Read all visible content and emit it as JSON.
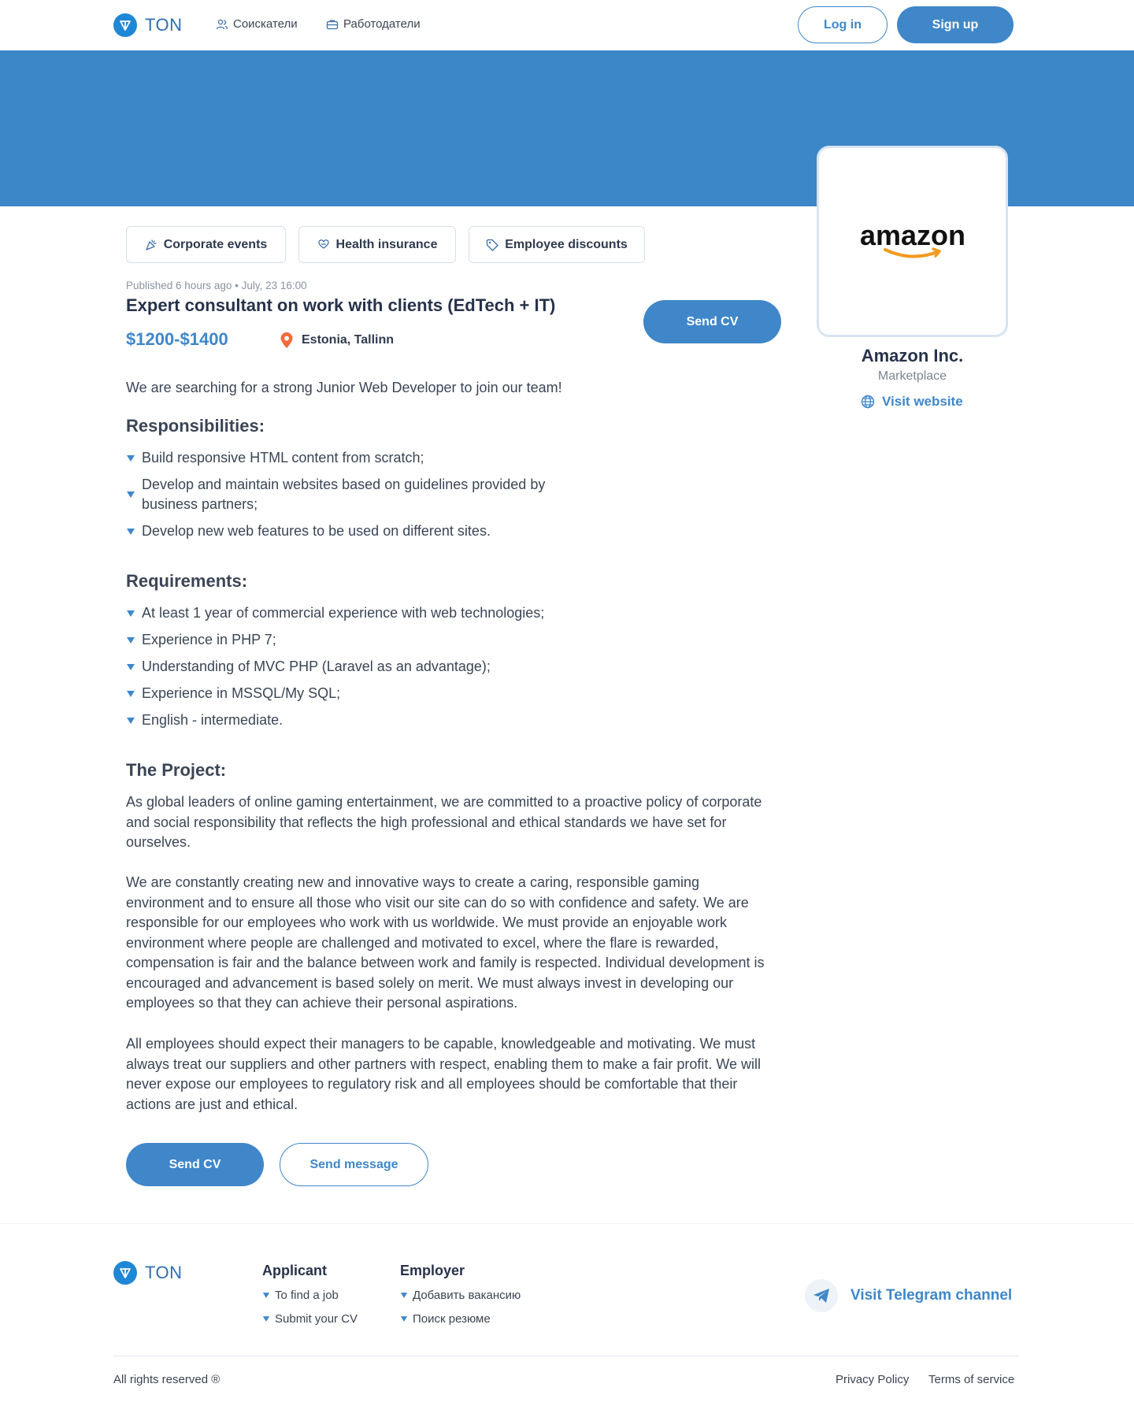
{
  "brand": {
    "name": "TON",
    "accent": "#3f87c9",
    "banner_color": "#3c87c7"
  },
  "nav": {
    "seekers": {
      "label": "Соискатели",
      "icon": "users-icon"
    },
    "employers": {
      "label": "Работодатели",
      "icon": "briefcase-icon"
    }
  },
  "auth": {
    "login": "Log in",
    "signup": "Sign up"
  },
  "company": {
    "logo_text": "amazon",
    "name": "Amazon Inc.",
    "category": "Marketplace",
    "website_label": "Visit website"
  },
  "benefits": [
    {
      "label": "Corporate events",
      "icon": "party-icon"
    },
    {
      "label": "Health insurance",
      "icon": "heart-hand-icon"
    },
    {
      "label": "Employee discounts",
      "icon": "tag-icon"
    }
  ],
  "job": {
    "meta": "Published 6 hours ago • July, 23 16:00",
    "title": "Expert consultant on work with clients (EdTech + IT)",
    "salary": "$1200-$1400",
    "location": "Estonia, Tallinn",
    "send_cv": "Send CV",
    "intro": "We are searching for a strong Junior Web Developer to join our team!",
    "responsibilities_title": "Responsibilities:",
    "responsibilities": [
      "Build responsive HTML content from scratch;",
      "Develop and maintain websites based on guidelines provided by business partners;",
      "Develop new web features to be used on different sites."
    ],
    "requirements_title": "Requirements:",
    "requirements": [
      "At least 1 year of commercial experience with web technologies;",
      "Experience in PHP 7;",
      "Understanding of MVC PHP (Laravel as an advantage);",
      "Experience in MSSQL/My SQL;",
      "English - intermediate."
    ],
    "project_title": "The Project:",
    "project_paragraphs": [
      "As global leaders of online gaming entertainment, we are committed to a proactive policy of corporate and social responsibility that reflects the high professional and ethical standards we have set for ourselves.",
      "We are constantly creating new and innovative ways to create a caring, responsible gaming environment and to ensure all those who visit our site can do so with confidence and safety. We are responsible for our employees who work with us worldwide. We must provide an enjoyable work environment where people are challenged and motivated to excel, where the flare is rewarded, compensation is fair and the balance between work and family is respected. Individual development is encouraged and advancement is based solely on merit. We must always invest in developing our employees so that they can achieve their personal aspirations.",
      "All employees should expect their managers to be capable, knowledgeable and motivating. We must always treat our suppliers and other partners with respect, enabling them to make a fair profit. We will never expose our employees to regulatory risk and all employees should be comfortable that their actions are just and ethical."
    ],
    "send_message": "Send message"
  },
  "footer": {
    "applicant_title": "Applicant",
    "applicant_links": [
      "To find a job",
      "Submit your CV"
    ],
    "employer_title": "Employer",
    "employer_links": [
      "Добавить вакансию",
      "Поиск резюме"
    ],
    "telegram": "Visit Telegram channel",
    "rights": "All rights reserved ®",
    "privacy": "Privacy Policy",
    "terms": "Terms of service"
  }
}
